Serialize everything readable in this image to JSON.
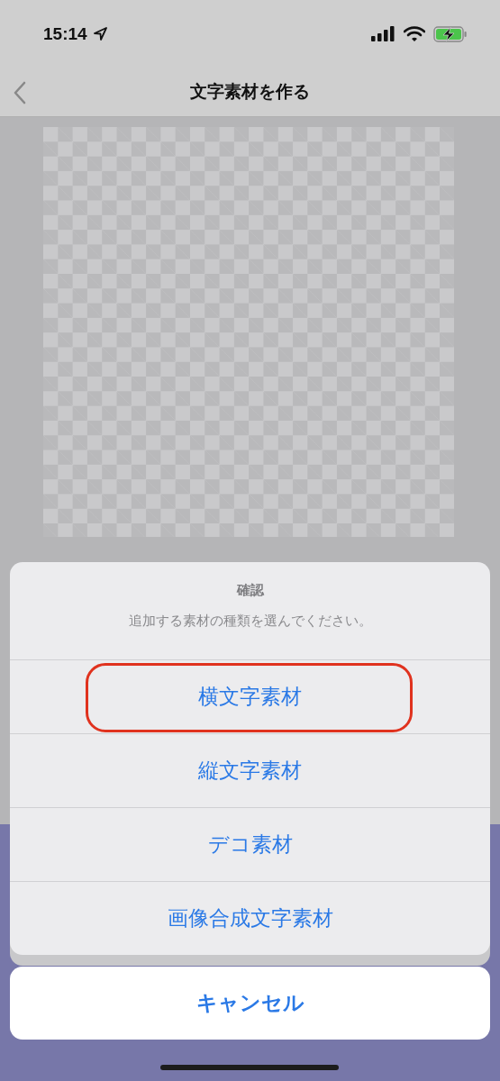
{
  "status_bar": {
    "time": "15:14"
  },
  "nav_bar": {
    "title": "文字素材を作る"
  },
  "action_sheet": {
    "title": "確認",
    "message": "追加する素材の種類を選んでください。",
    "options": [
      {
        "label": "横文字素材",
        "highlighted": true
      },
      {
        "label": "縦文字素材",
        "highlighted": false
      },
      {
        "label": "デコ素材",
        "highlighted": false
      },
      {
        "label": "画像合成文字素材",
        "highlighted": false
      }
    ],
    "cancel": "キャンセル"
  }
}
